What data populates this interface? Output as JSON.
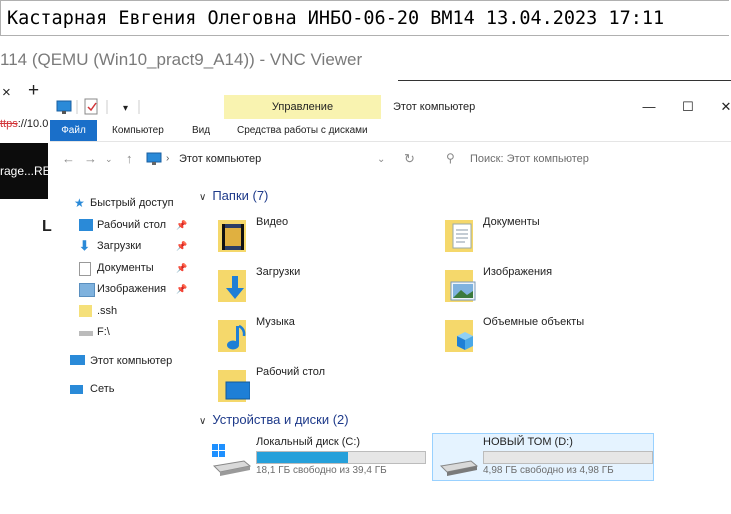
{
  "watermark": "Кастарная Евгения Олеговна ИНБО-06-20 ВМ14 13.04.2023 17:11",
  "vnc_title": "114 (QEMU (Win10_pract9_A14)) - VNC Viewer",
  "browser": {
    "tab_close": "×",
    "tab_add": "+",
    "url_scheme": "ttps",
    "url_rest": "://10.0",
    "panel_text": "rage...RE",
    "stray_letter": "L"
  },
  "explorer": {
    "context_tab": "Управление",
    "title": "Этот компьютер",
    "window_buttons": {
      "minimize": "—",
      "maximize": "☐",
      "close": "✕"
    },
    "ribbon": [
      "Файл",
      "Компьютер",
      "Вид",
      "Средства работы с дисками"
    ],
    "address": "Этот компьютер",
    "search_placeholder": "Поиск: Этот компьютер",
    "nav": {
      "quick_access": "Быстрый доступ",
      "items": [
        "Рабочий стол",
        "Загрузки",
        "Документы",
        "Изображения",
        ".ssh",
        "F:\\"
      ],
      "this_pc": "Этот компьютер",
      "network": "Сеть"
    },
    "folders_header": "Папки (7)",
    "folders": [
      "Видео",
      "Документы",
      "Загрузки",
      "Изображения",
      "Музыка",
      "Объемные объекты",
      "Рабочий стол"
    ],
    "devices_header": "Устройства и диски (2)",
    "drives": [
      {
        "name": "Локальный диск (C:)",
        "free": "18,1 ГБ свободно из 39,4 ГБ",
        "used_fraction": 0.54
      },
      {
        "name": "НОВЫЙ ТОМ (D:)",
        "free": "4,98 ГБ свободно из 4,98 ГБ",
        "used_fraction": 0.0
      }
    ],
    "colors": {
      "accent": "#1a6fc9",
      "context_band": "#f9f3b0",
      "drive_fill": "#26a0da",
      "header_text": "#1e3a8a"
    }
  }
}
